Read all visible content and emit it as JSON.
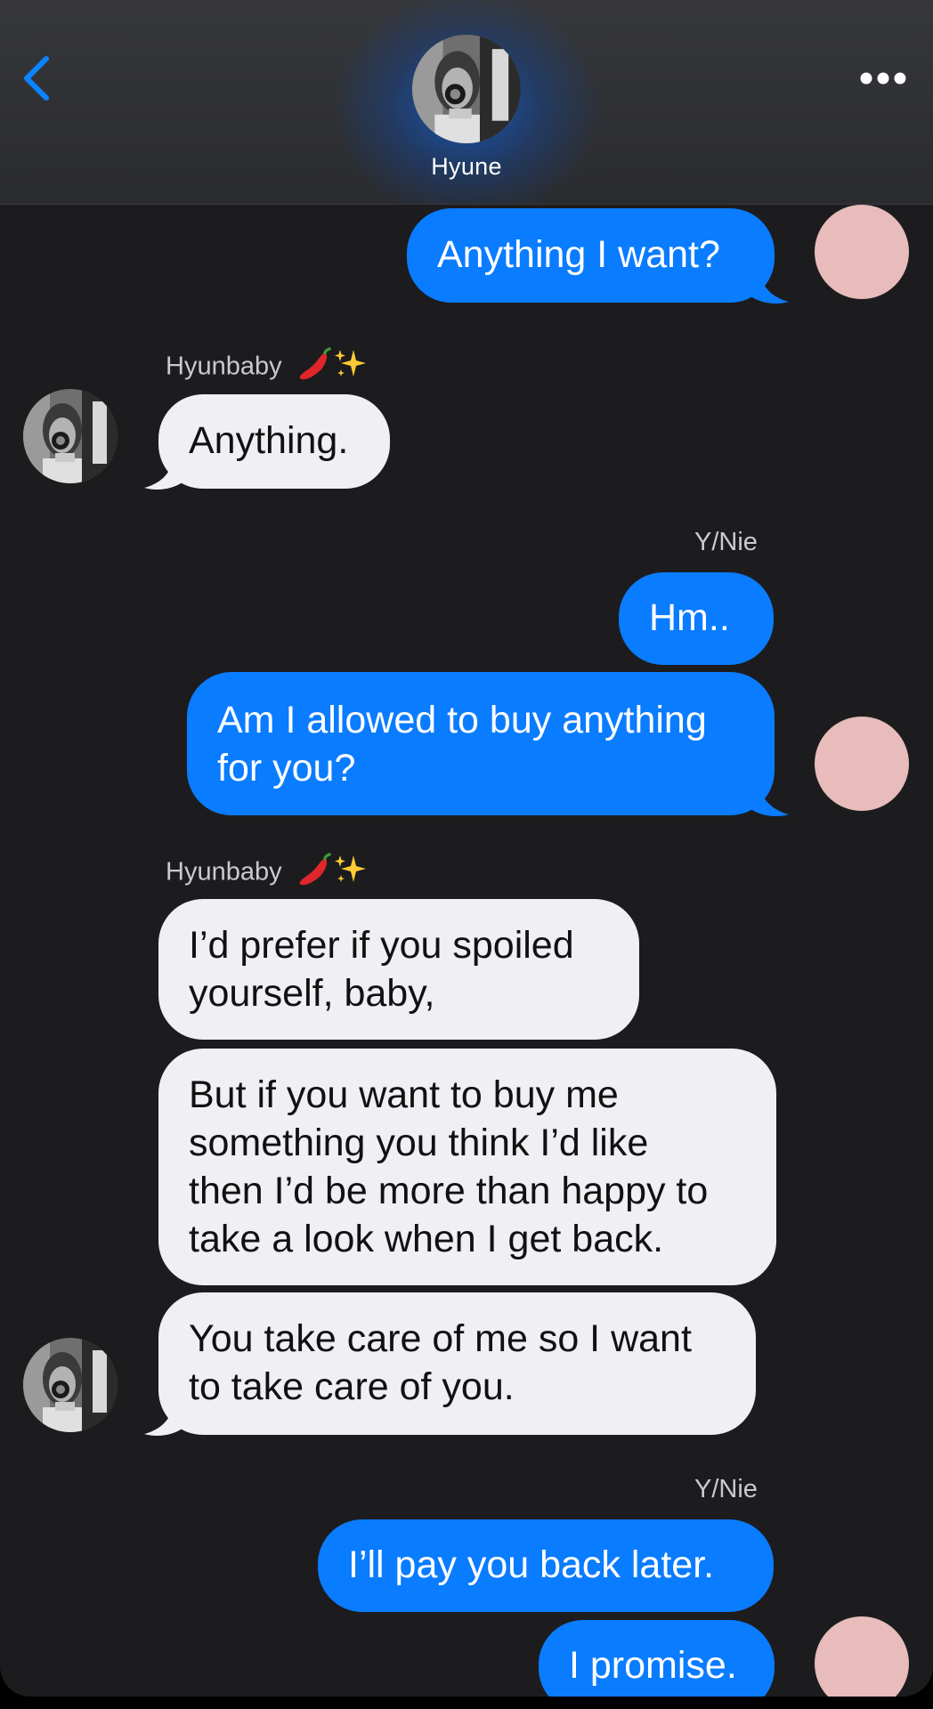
{
  "header": {
    "contact_name": "Hyune",
    "back_icon": "chevron-left-icon",
    "more_icon": "ellipsis-icon",
    "accent": "#0a7cff"
  },
  "colors": {
    "outgoing_bubble": "#0a7cff",
    "incoming_bubble": "#efeff4",
    "background": "#1c1c1e",
    "my_avatar": "#e7bcbb"
  },
  "messages": [
    {
      "from": "me",
      "lines": [
        "Anything I want?"
      ]
    },
    {
      "from": "them",
      "sender": "Hyunbaby",
      "lines": [
        "Anything."
      ]
    },
    {
      "from": "me",
      "sender": "Y/Nie",
      "lines": [
        "Hm.."
      ]
    },
    {
      "from": "me",
      "lines": [
        "Am I allowed to buy anything",
        "for you?"
      ]
    },
    {
      "from": "them",
      "sender": "Hyunbaby",
      "lines": [
        "I’d prefer if you spoiled",
        "yourself, baby,"
      ]
    },
    {
      "from": "them",
      "lines": [
        "But if you want to buy me",
        "something you think I’d like",
        "then I’d be more than happy to",
        "take a look when I get back."
      ]
    },
    {
      "from": "them",
      "lines": [
        "You take care of me so I want",
        "to take care of you."
      ]
    },
    {
      "from": "me",
      "sender": "Y/Nie",
      "lines": [
        "I’ll pay you back later."
      ]
    },
    {
      "from": "me",
      "lines": [
        "I promise."
      ]
    }
  ]
}
